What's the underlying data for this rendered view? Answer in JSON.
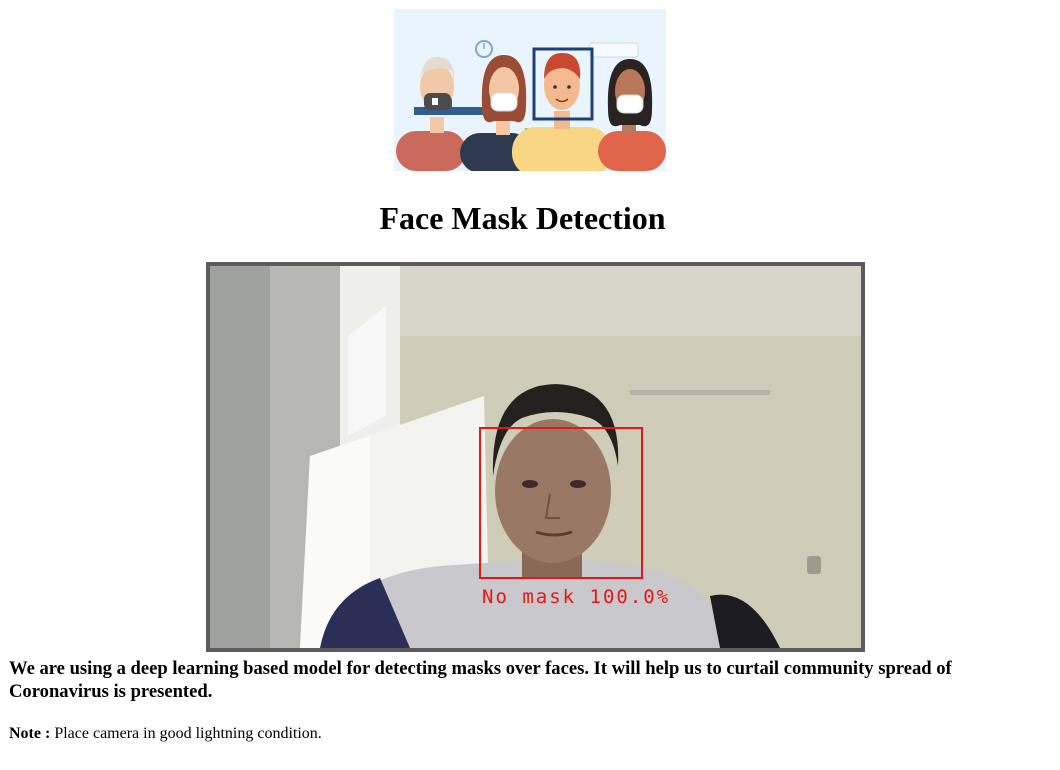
{
  "page": {
    "title": "Face Mask Detection",
    "description": "We are using a deep learning based model for detecting masks over faces. It will help us to curtail community spread of Coronavirus is presented.",
    "note_label": "Note :",
    "note_text": "Place camera in good lightning condition."
  },
  "camera_feed": {
    "detection_label": "No mask 100.0%",
    "box_color": "#e01818"
  },
  "colors": {
    "background": "#ffffff",
    "feed_border": "#5c5c5c",
    "banner_bg": "#e9f4fc"
  }
}
